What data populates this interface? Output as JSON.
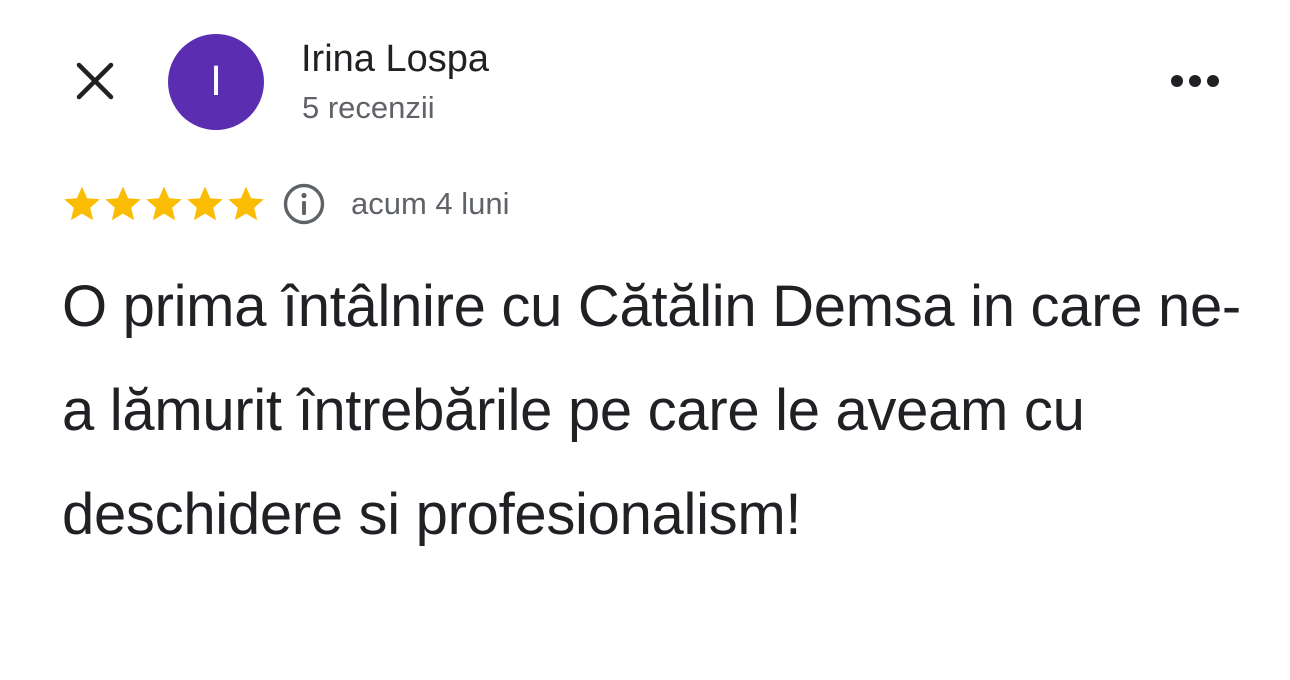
{
  "header": {
    "close_icon": "close-icon",
    "avatar_letter": "I",
    "avatar_color": "#5b2db1",
    "reviewer_name": "Irina Lospa",
    "review_count": "5 recenzii",
    "more_icon": "more-horiz-icon"
  },
  "rating": {
    "stars": 5,
    "max_stars": 5,
    "star_color": "#fbbc04",
    "info_icon": "info-icon",
    "time_ago": "acum 4 luni"
  },
  "review": {
    "text": "O prima întâlnire cu Cătălin Demsa in care ne-a lămurit întrebările pe care le aveam cu deschidere si profesionalism!"
  }
}
